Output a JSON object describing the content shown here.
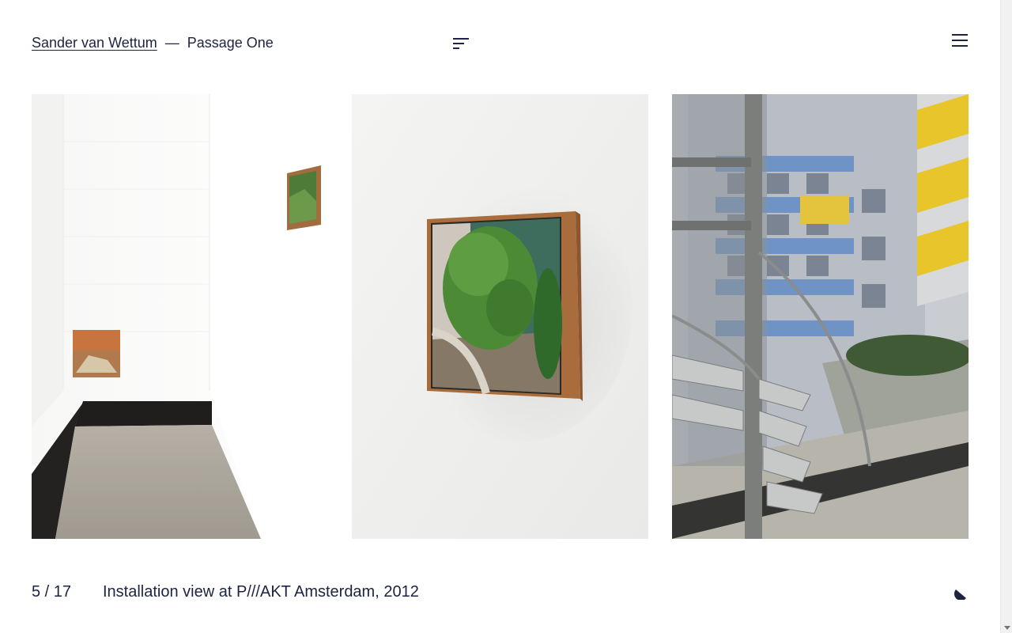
{
  "header": {
    "artist": "Sander van Wettum",
    "separator": "—",
    "project": "Passage One",
    "index_icon": "index-lines-icon",
    "menu_icon": "hamburger-menu-icon"
  },
  "gallery": {
    "photos": [
      {
        "name": "installation-corridor-photo"
      },
      {
        "name": "framed-shrub-photo"
      },
      {
        "name": "spiral-staircase-photo"
      }
    ]
  },
  "footer": {
    "counter": "5 / 17",
    "caption": "Installation view at P///AKT Amsterdam, 2012",
    "theme_icon": "half-moon-icon"
  },
  "colors": {
    "text": "#1d2340",
    "background": "#ffffff"
  }
}
